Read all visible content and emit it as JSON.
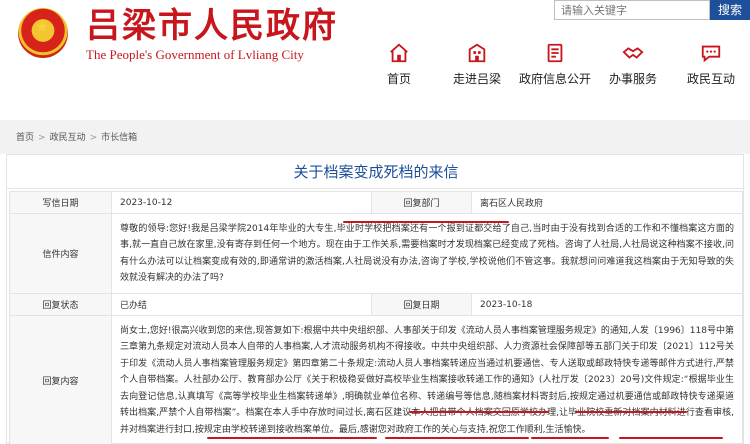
{
  "header": {
    "title": "吕梁市人民政府",
    "subtitle": "The People's Government of Lvliang City",
    "search_placeholder": "请输入关键字",
    "search_label": "搜索"
  },
  "nav": [
    {
      "label": "首页",
      "icon": "home-icon"
    },
    {
      "label": "走进吕梁",
      "icon": "building-icon"
    },
    {
      "label": "政府信息公开",
      "icon": "document-icon"
    },
    {
      "label": "办事服务",
      "icon": "handshake-icon"
    },
    {
      "label": "政民互动",
      "icon": "chat-icon"
    }
  ],
  "breadcrumb": [
    "首页",
    "政民互动",
    "市长信箱"
  ],
  "letter": {
    "title": "关于档案变成死档的来信",
    "write_date_label": "写信日期",
    "write_date": "2023-10-12",
    "dept_label": "回复部门",
    "dept": "离石区人民政府",
    "content_label": "信件内容",
    "content": "尊敬的领导:您好!我是吕梁学院2014年毕业的大专生,毕业时学校把档案还有一个报到证都交给了自己,当时由于没有找到合适的工作和不懂档案这方面的事,就一直自己放在家里,没有寄存到任何一个地方。现在由于工作关系,需要档案时才发现档案已经变成了死档。咨询了人社局,人社局说这种档案不接收,问有什么办法可以让档案变成有效的,即通常讲的激活档案,人社局说没有办法,咨询了学校,学校说他们不管这事。我就想问问难道我这档案由于无知导致的失效就没有解决的办法了吗?",
    "status_label": "回复状态",
    "status": "已办结",
    "reply_date_label": "回复日期",
    "reply_date": "2023-10-18",
    "reply_label": "回复内容",
    "reply": "尚女士,您好!很高兴收到您的来信,现答复如下:根据中共中央组织部、人事部关于印发《流动人员人事档案管理服务规定》的通知,人发〔1996〕118号中第三章第九条规定对流动人员本人自带的人事档案,人才流动服务机构不得接收。中共中央组织部、人力资源社会保障部等五部门关于印发〔2021〕112号关于印发《流动人员人事档案管理服务规定》第四章第二十条规定:流动人员人事档案转递应当通过机要通信、专人送取或邮政特快专递等邮件方式进行,严禁个人自带档案。人社部办公厅、教育部办公厅《关于积极稳妥做好高校毕业生档案接收转递工作的通知》(人社厅发〔2023〕20号)文件规定:“根据毕业生去向登记信息,认真填写《高等学校毕业生档案转递单》,明确就业单位名称、转递编号等信息,随档案材料寄封后,按规定通过机要通信或邮政特快专递渠道转出档案,严禁个人自带档案”。档案在本人手中存放时间过长,离石区建议本人把自带个人档案交回原学校办理,让毕业院校重新对档案内材料进行查看审核,并对档案进行封口,按规定由学校转递到接收档案单位。最后,感谢您对政府工作的关心与支持,祝您工作顺利,生活愉快。"
  }
}
